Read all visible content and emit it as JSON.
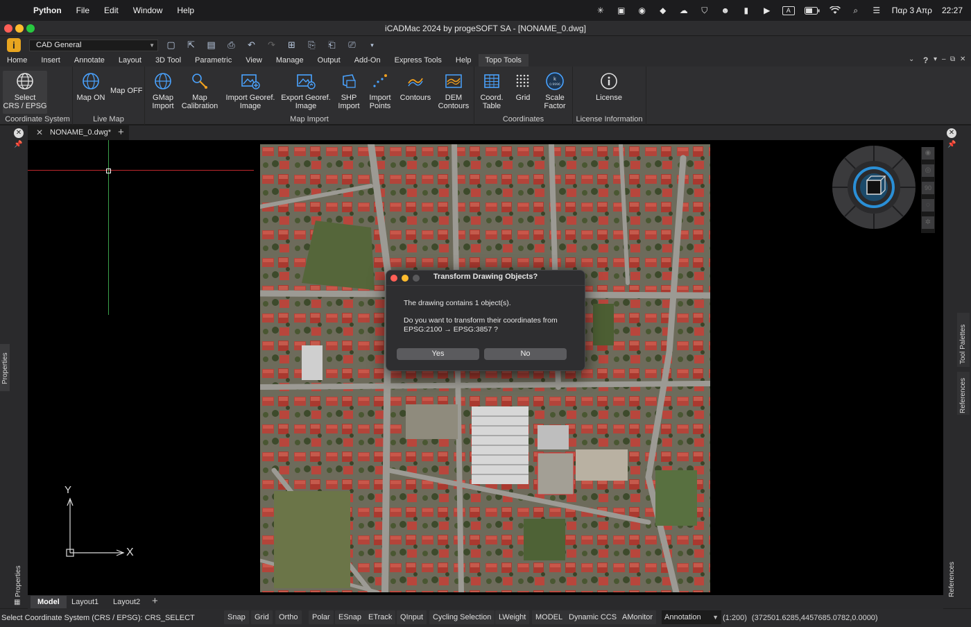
{
  "menubar": {
    "app": "Python",
    "items": [
      "File",
      "Edit",
      "Window",
      "Help"
    ],
    "date": "Παρ 3 Απρ",
    "time": "22:27",
    "input_source": "A"
  },
  "window": {
    "title": "iCADMac 2024 by progeSOFT SA - [NONAME_0.dwg]"
  },
  "qat": {
    "workspace": "CAD General"
  },
  "ribbon_tabs": [
    "Home",
    "Insert",
    "Annotate",
    "Layout",
    "3D Tool",
    "Parametric",
    "View",
    "Manage",
    "Output",
    "Add-On",
    "Express Tools",
    "Help",
    "Topo Tools"
  ],
  "ribbon": {
    "coord_system": {
      "label": "Coordinate System",
      "select_line1": "Select",
      "select_line2": "CRS / EPSG"
    },
    "live_map": {
      "label": "Live Map",
      "map_on": "Map ON",
      "map_off": "Map OFF"
    },
    "map_import": {
      "label": "Map Import",
      "gmap1": "GMap",
      "gmap2": "Import",
      "calib1": "Map",
      "calib2": "Calibration",
      "impgeo1": "Import Georef.",
      "impgeo2": "Image",
      "expgeo1": "Export Georef.",
      "expgeo2": "Image",
      "shp1": "SHP",
      "shp2": "Import",
      "pts1": "Import",
      "pts2": "Points",
      "contours": "Contours",
      "dem1": "DEM",
      "dem2": "Contours"
    },
    "coordinates": {
      "label": "Coordinates",
      "table1": "Coord.",
      "table2": "Table",
      "grid": "Grid",
      "scale1": "Scale",
      "scale2": "Factor"
    },
    "license": {
      "label": "License Information",
      "license": "License"
    }
  },
  "doc_tab": "NONAME_0.dwg*",
  "side_labels": {
    "left": "Properties",
    "left_bottom": "Properties",
    "right_top": "Tool Palettes",
    "right_mid": "References",
    "right_bottom": "References"
  },
  "dialog": {
    "title": "Transform Drawing Objects?",
    "line1": "The drawing contains 1 object(s).",
    "line2": "Do you want to transform their coordinates from",
    "line3": "EPSG:2100  →  EPSG:3857 ?",
    "yes": "Yes",
    "no": "No"
  },
  "ucs": {
    "x": "X",
    "y": "Y"
  },
  "layout_tabs": [
    "Model",
    "Layout1",
    "Layout2"
  ],
  "statusbar": {
    "prompt": "Select Coordinate System (CRS / EPSG): CRS_SELECT",
    "buttons": [
      "Snap",
      "Grid",
      "Ortho",
      "Polar",
      "ESnap",
      "ETrack",
      "QInput",
      "Cycling Selection",
      "LWeight",
      "MODEL",
      "Dynamic CCS",
      "AMonitor"
    ],
    "annotation": "Annotation",
    "scale": "(1:200)",
    "coords": "(372501.6285,4457685.0782,0.0000)"
  },
  "navwheel_labels": {
    "ninety": "90"
  },
  "colors": {
    "accent": "#4aa3ff",
    "crosshair_x": "#c0282d",
    "crosshair_y": "#3aa04a",
    "logo": "#e8a520"
  }
}
